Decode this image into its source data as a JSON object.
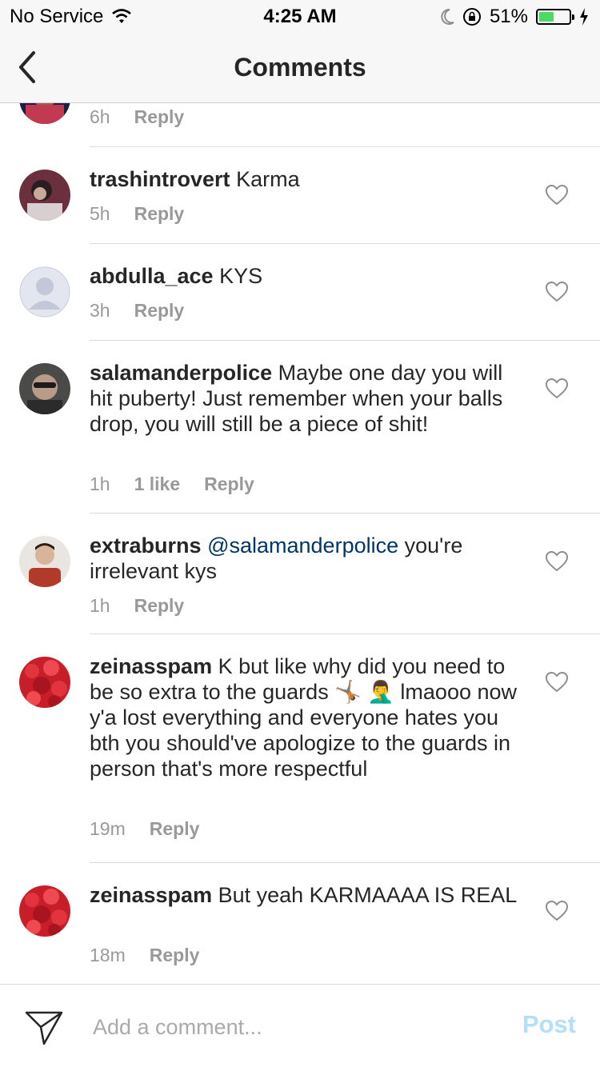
{
  "status_bar": {
    "carrier": "No Service",
    "time": "4:25 AM",
    "battery_percent": "51%",
    "battery_level": 0.51,
    "icons": [
      "wifi-icon",
      "moon-icon",
      "rotation-lock-icon",
      "battery-icon",
      "charging-bolt-icon"
    ]
  },
  "nav": {
    "title": "Comments",
    "back_icon": "chevron-left-icon"
  },
  "comments": [
    {
      "time": "6h",
      "reply": "Reply"
    },
    {
      "username": "trashintrovert",
      "text": "Karma",
      "time": "5h",
      "reply": "Reply"
    },
    {
      "username": "abdulla_ace",
      "text": "KYS",
      "time": "3h",
      "reply": "Reply"
    },
    {
      "username": "salamanderpolice",
      "text": "Maybe one day you will hit puberty! Just remember when your balls drop, you will still be a piece of shit!",
      "time": "1h",
      "likes": "1 like",
      "reply": "Reply"
    },
    {
      "username": "extraburns",
      "mention": "@salamanderpolice",
      "text": "you're irrelevant kys",
      "time": "1h",
      "reply": "Reply"
    },
    {
      "username": "zeinasspam",
      "text": "K but like why did you need to be so extra to the guards 🤸🏽 🤦‍♂️ lmaooo now y'a lost everything and everyone hates you bth you should've apologize to the guards in person that's more respectful",
      "time": "19m",
      "reply": "Reply"
    },
    {
      "username": "zeinasspam",
      "text": "But yeah KARMAAAA IS REAL",
      "time": "18m",
      "reply": "Reply"
    }
  ],
  "composer": {
    "placeholder": "Add a comment...",
    "post_label": "Post",
    "post_color": "#b2dffc"
  },
  "colors": {
    "mention": "#003569",
    "meta": "#999999",
    "divider": "#dbdbdb",
    "battery": "#4cd964"
  }
}
